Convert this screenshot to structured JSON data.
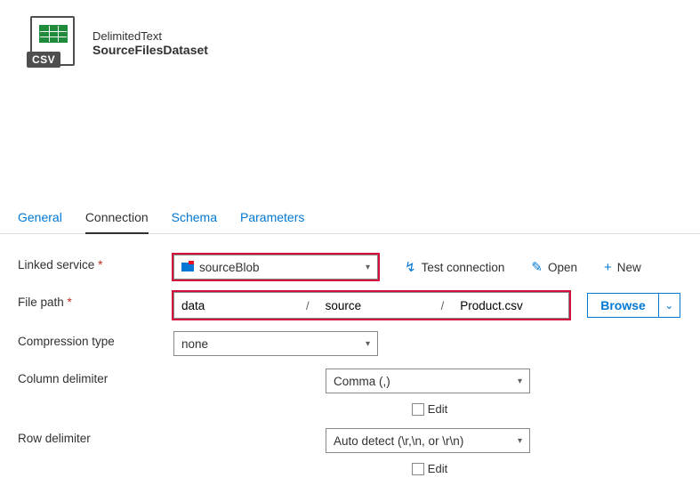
{
  "header": {
    "type_label": "DelimitedText",
    "name": "SourceFilesDataset",
    "icon_tag": "CSV"
  },
  "tabs": {
    "general": "General",
    "connection": "Connection",
    "schema": "Schema",
    "parameters": "Parameters",
    "active": "connection"
  },
  "labels": {
    "linked_service": "Linked service",
    "file_path": "File path",
    "compression_type": "Compression type",
    "column_delimiter": "Column delimiter",
    "row_delimiter": "Row delimiter",
    "edit": "Edit",
    "required_marker": "*"
  },
  "linked_service": {
    "value": "sourceBlob",
    "actions": {
      "test_connection": "Test connection",
      "open": "Open",
      "new": "New"
    }
  },
  "file_path": {
    "container": "data",
    "directory": "source",
    "file": "Product.csv",
    "separator": "/",
    "browse": "Browse"
  },
  "compression_type": {
    "value": "none"
  },
  "column_delimiter": {
    "value": "Comma (,)",
    "edit_checked": false
  },
  "row_delimiter": {
    "value": "Auto detect (\\r,\\n, or \\r\\n)",
    "edit_checked": false
  },
  "icons": {
    "test_connection": "✓",
    "open": "✎",
    "new": "+",
    "caret_down": "▾",
    "chevron_down": "⌄"
  }
}
